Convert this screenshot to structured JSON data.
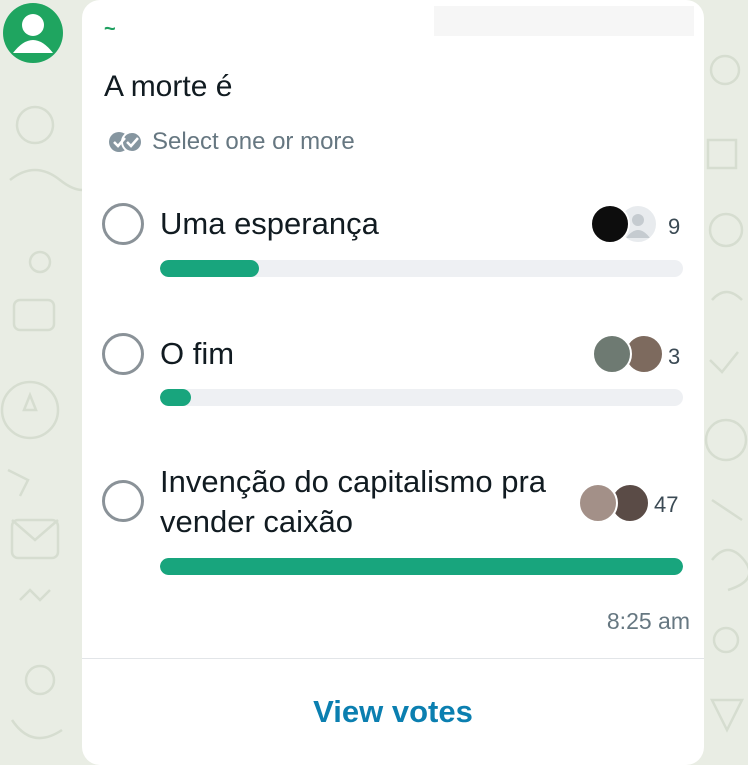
{
  "chat": {
    "sender_name": "~",
    "timestamp": "8:25 am"
  },
  "poll": {
    "question": "A morte é",
    "select_hint": "Select one or more",
    "view_votes_label": "View votes",
    "accent_color": "#18a57d",
    "options": [
      {
        "label": "Uma esperança",
        "votes": "9",
        "fill_percent": 19
      },
      {
        "label": "O fim",
        "votes": "3",
        "fill_percent": 6
      },
      {
        "label": "Invenção do capitalismo pra vender caixão",
        "votes": "47",
        "fill_percent": 100
      }
    ]
  },
  "icons": {
    "avatar": "default-user-avatar-icon",
    "select_hint": "double-check-icon",
    "voters": "voter-avatar-icon"
  }
}
